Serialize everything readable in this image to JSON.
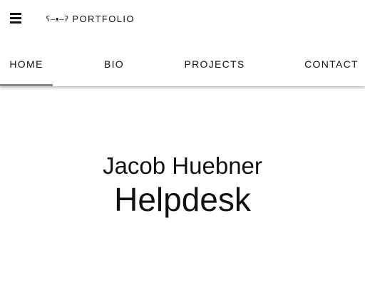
{
  "header": {
    "menu_icon": "hamburger-menu-icon",
    "brand": {
      "logo_text": "ʕ–ᴥ–ʔ",
      "title": "PORTFOLIO"
    },
    "tabs": [
      {
        "label": "HOME",
        "active": true
      },
      {
        "label": "BIO",
        "active": false
      },
      {
        "label": "PROJECTS",
        "active": false
      },
      {
        "label": "CONTACT",
        "active": false
      }
    ],
    "active_indicator_color": "#888888"
  },
  "hero": {
    "name": "Jacob Huebner",
    "role": "Helpdesk"
  }
}
